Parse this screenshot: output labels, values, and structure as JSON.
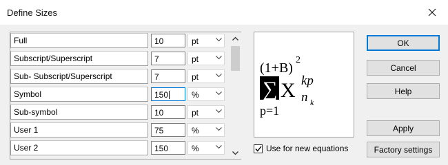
{
  "dialog": {
    "title": "Define Sizes",
    "close_icon": "close-icon"
  },
  "sizes": [
    {
      "label": "Full",
      "value": "10",
      "unit": "pt"
    },
    {
      "label": "Subscript/Superscript",
      "value": "7",
      "unit": "pt"
    },
    {
      "label": "Sub- Subscript/Superscript",
      "value": "7",
      "unit": "pt"
    },
    {
      "label": "Symbol",
      "value": "150",
      "unit": "%"
    },
    {
      "label": "Sub-symbol",
      "value": "10",
      "unit": "pt"
    },
    {
      "label": "User 1",
      "value": "75",
      "unit": "%"
    },
    {
      "label": "User 2",
      "value": "150",
      "unit": "%"
    }
  ],
  "preview": {
    "base": "(1+B)",
    "base_exp": "2",
    "symbol": "∑",
    "var": "X",
    "sup": "kp",
    "sub": "n",
    "subsub": "k",
    "lower_limit": "p=1"
  },
  "checkbox": {
    "label": "Use for new equations",
    "checked": true
  },
  "buttons": {
    "ok": "OK",
    "cancel": "Cancel",
    "help": "Help",
    "apply": "Apply",
    "factory": "Factory settings"
  },
  "colors": {
    "focus": "#0078d7",
    "body_bg": "#f0f0f0",
    "button_bg": "#e1e1e1"
  }
}
